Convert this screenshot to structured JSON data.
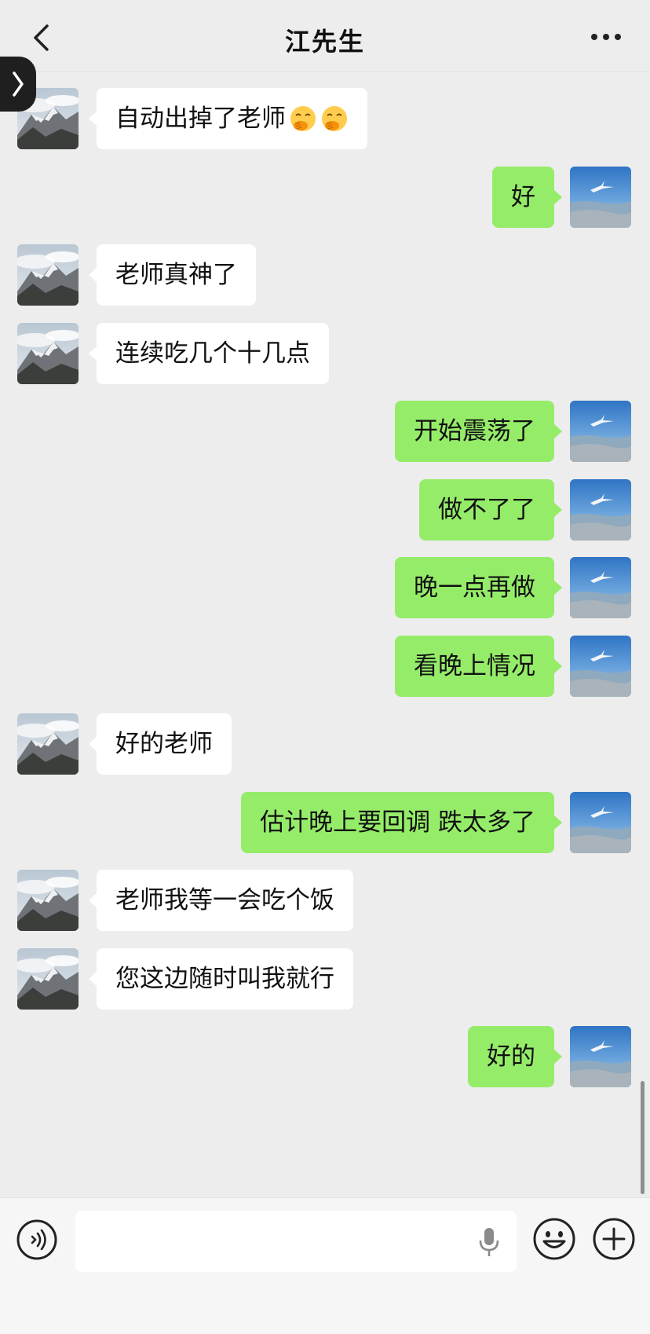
{
  "header": {
    "title": "江先生"
  },
  "icons": {
    "back": "chevron-left-icon",
    "more": "more-dots-icon",
    "side_tab": "chevron-right-icon",
    "voice": "voice-icon",
    "mic": "microphone-icon",
    "emoji": "smiley-face-icon",
    "plus": "plus-icon"
  },
  "colors": {
    "background": "#ededed",
    "bubble_self": "#95ec69",
    "bubble_other": "#ffffff"
  },
  "messages": [
    {
      "side": "left",
      "text": "自动出掉了老师",
      "emoji_count": 2,
      "emoji": "face-with-hand-over-mouth"
    },
    {
      "side": "right",
      "text": "好"
    },
    {
      "side": "left",
      "text": "老师真神了"
    },
    {
      "side": "left",
      "text": "连续吃几个十几点"
    },
    {
      "side": "right",
      "text": "开始震荡了"
    },
    {
      "side": "right",
      "text": "做不了了"
    },
    {
      "side": "right",
      "text": "晚一点再做"
    },
    {
      "side": "right",
      "text": "看晚上情况"
    },
    {
      "side": "left",
      "text": "好的老师"
    },
    {
      "side": "right",
      "text": "估计晚上要回调 跌太多了"
    },
    {
      "side": "left",
      "text": "老师我等一会吃个饭"
    },
    {
      "side": "left",
      "text": "您这边随时叫我就行"
    },
    {
      "side": "right",
      "text": "好的"
    }
  ],
  "input": {
    "value": "",
    "placeholder": ""
  }
}
